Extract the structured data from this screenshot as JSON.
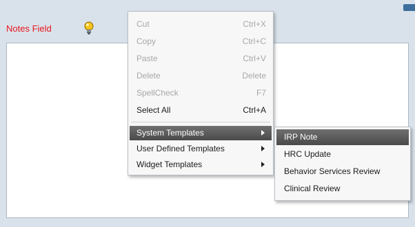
{
  "notes_field": {
    "label": "Notes Field",
    "icons": {
      "hint": "lightbulb-icon"
    }
  },
  "context_menu": {
    "items": [
      {
        "label": "Cut",
        "shortcut": "Ctrl+X",
        "enabled": false
      },
      {
        "label": "Copy",
        "shortcut": "Ctrl+C",
        "enabled": false
      },
      {
        "label": "Paste",
        "shortcut": "Ctrl+V",
        "enabled": false
      },
      {
        "label": "Delete",
        "shortcut": "Delete",
        "enabled": false
      },
      {
        "label": "SpellCheck",
        "shortcut": "F7",
        "enabled": false
      },
      {
        "label": "Select All",
        "shortcut": "Ctrl+A",
        "enabled": true
      }
    ],
    "submenus": [
      {
        "label": "System Templates",
        "active": true,
        "icon": "chevron-right-icon"
      },
      {
        "label": "User Defined Templates",
        "active": false,
        "icon": "chevron-right-icon"
      },
      {
        "label": "Widget Templates",
        "active": false,
        "icon": "chevron-right-icon"
      }
    ]
  },
  "system_templates_submenu": {
    "items": [
      {
        "label": "IRP Note",
        "active": true
      },
      {
        "label": "HRC Update",
        "active": false
      },
      {
        "label": "Behavior Services Review",
        "active": false
      },
      {
        "label": "Clinical Review",
        "active": false
      }
    ]
  },
  "colors": {
    "label_red": "#e8151b",
    "disabled_text": "#a7a7a7",
    "highlight_dark": "#555555",
    "panel_background": "#d9e2eb"
  }
}
